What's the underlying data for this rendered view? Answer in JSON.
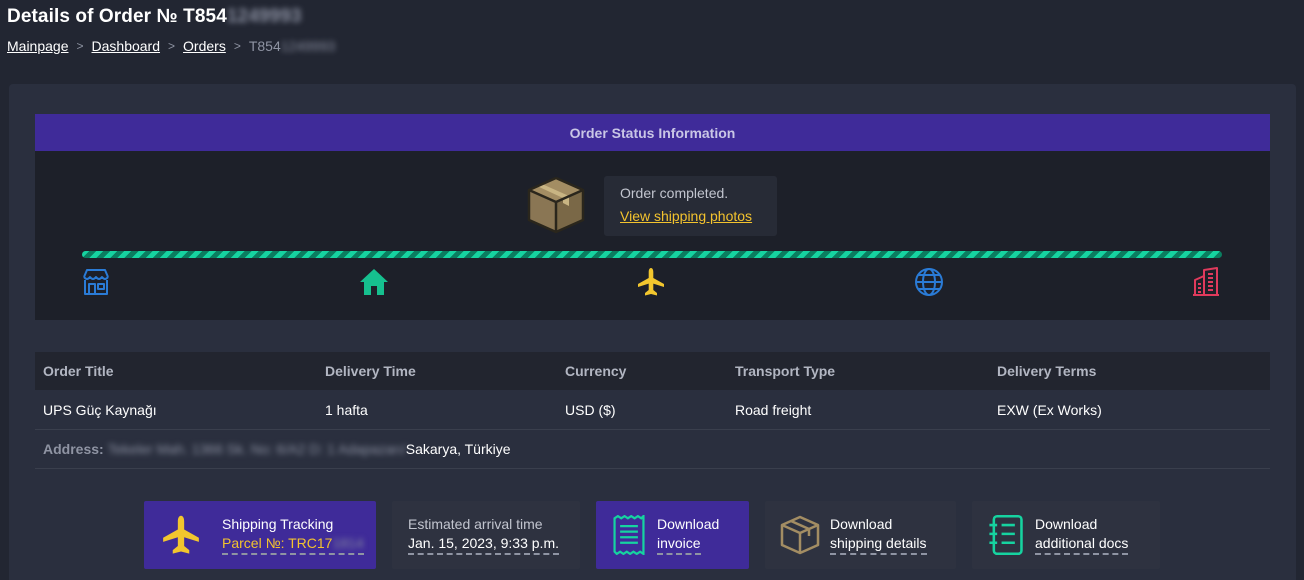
{
  "header": {
    "title_prefix": "Details of Order № T854",
    "title_redacted": "1249993"
  },
  "breadcrumb": {
    "items": [
      "Mainpage",
      "Dashboard",
      "Orders"
    ],
    "separator": ">",
    "current_prefix": "T854",
    "current_redacted": "1249993"
  },
  "status": {
    "header": "Order Status Information",
    "message": "Order completed.",
    "link": "View shipping photos",
    "steps": [
      "store-icon",
      "home-icon",
      "airplane-icon",
      "globe-icon",
      "building-icon"
    ]
  },
  "details": {
    "columns": [
      "Order Title",
      "Delivery Time",
      "Currency",
      "Transport Type",
      "Delivery Terms"
    ],
    "values": [
      "UPS Güç Kaynağı",
      "1 hafta",
      "USD ($)",
      "Road freight",
      "EXW (Ex Works)"
    ],
    "address_label": "Address:",
    "address_redacted": "Tekeler Mah. 1366 Sk. No: 6/A2 D: 1 Adapazarı/",
    "address_visible": "Sakarya, Türkiye"
  },
  "actions": {
    "tracking": {
      "line1": "Shipping Tracking",
      "line2_prefix": "Parcel №: TRC17",
      "line2_redacted": "1814"
    },
    "arrival": {
      "line1": "Estimated arrival time",
      "line2": "Jan. 15, 2023, 9:33 p.m."
    },
    "invoice": {
      "line1": "Download",
      "line2": "invoice"
    },
    "shipping": {
      "line1": "Download",
      "line2": "shipping details"
    },
    "docs": {
      "line1": "Download",
      "line2": "additional docs"
    }
  },
  "colors": {
    "background": "#222632",
    "panel": "#2a2f3e",
    "accent_purple": "#3f2b99",
    "progress_green": "#16d3a0",
    "link_yellow": "#f3c32e"
  }
}
